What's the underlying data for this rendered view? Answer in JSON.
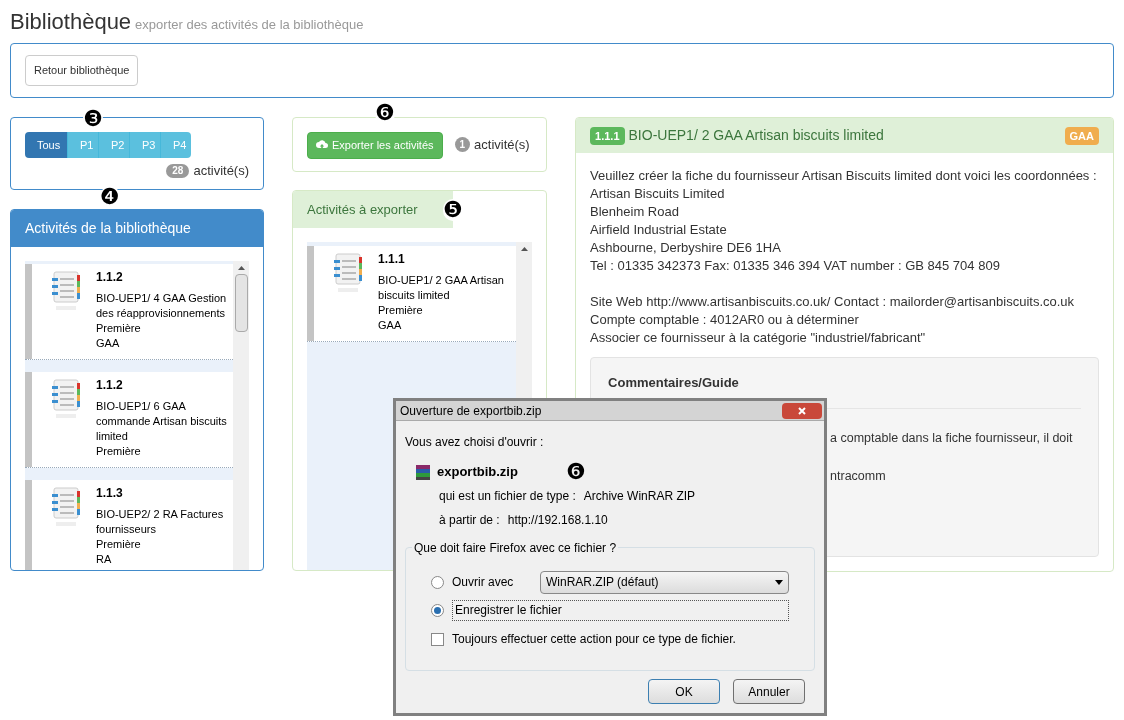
{
  "header": {
    "title": "Bibliothèque",
    "subtitle": "exporter des activités de la bibliothèque"
  },
  "back_button": "Retour bibliothèque",
  "filter": {
    "marker": "❸",
    "tabs": [
      {
        "label": "Tous",
        "selected": true
      },
      {
        "label": "P1",
        "selected": false
      },
      {
        "label": "P2",
        "selected": false
      },
      {
        "label": "P3",
        "selected": false
      },
      {
        "label": "P4",
        "selected": false
      }
    ],
    "count": "28",
    "count_label": "activité(s)"
  },
  "library": {
    "marker": "❹",
    "title": "Activités de la bibliothèque",
    "items": [
      {
        "code": "1.1.2",
        "title": "BIO-UEP1/ 4 GAA Gestion des réapprovisionnements",
        "level": "Première",
        "domain": "GAA"
      },
      {
        "code": "1.1.2",
        "title": "BIO-UEP1/ 6 GAA commande Artisan biscuits limited",
        "level": "Première"
      },
      {
        "code": "1.1.3",
        "title": "BIO-UEP2/ 2 RA Factures fournisseurs",
        "level": "Première",
        "domain": "RA"
      }
    ]
  },
  "export": {
    "marker": "❻",
    "button": "Exporter les activités",
    "count": "1",
    "count_label": "activité(s)"
  },
  "to_export": {
    "marker": "❺",
    "title": "Activités à exporter",
    "items": [
      {
        "code": "1.1.1",
        "title": "BIO-UEP1/ 2 GAA Artisan biscuits limited",
        "level": "Première",
        "domain": "GAA"
      }
    ]
  },
  "detail": {
    "code": "1.1.1",
    "title": "BIO-UEP1/ 2 GAA Artisan biscuits limited",
    "tag": "GAA",
    "paragraphs": [
      [
        "Veuillez créer la fiche du fournisseur Artisan Biscuits limited dont voici les coordonnées :",
        "Artisan Biscuits Limited",
        "Blenheim Road",
        "Airfield Industrial Estate",
        "Ashbourne, Derbyshire DE6 1HA",
        "Tel : 01335 342373 Fax: 01335 346 394 VAT number : GB 845 704 809"
      ],
      [
        "Site Web http://www.artisanbiscuits.co.uk/ Contact : mailorder@artisanbiscuits.co.uk",
        "Compte comptable : 4012AR0 ou à déterminer",
        "Associer ce fournisseur à la catégorie \"industriel/fabricant\""
      ]
    ],
    "comments": {
      "title": "Commentaires/Guide",
      "lines": [
        "a comptable dans la fiche fournisseur, il doit",
        "ntracomm"
      ]
    }
  },
  "dialog": {
    "title": "Ouverture de exportbib.zip",
    "intro": "Vous avez choisi d'ouvrir :",
    "file": "exportbib.zip",
    "marker": "❻",
    "type_label": "qui est un fichier de type :",
    "type": "Archive WinRAR ZIP",
    "from_label": "à partir de :",
    "from": "http://192.168.1.10",
    "group_title": "Que doit faire Firefox avec ce fichier ?",
    "options": [
      {
        "kind": "select",
        "label": "Ouvrir avec",
        "selected": false,
        "app": "WinRAR.ZIP (défaut)"
      },
      {
        "kind": "plain",
        "label": "Enregistrer le fichier",
        "selected": true
      }
    ],
    "always": {
      "label": "Toujours effectuer cette action pour ce type de fichier.",
      "checked": false
    },
    "buttons": [
      "OK",
      "Annuler"
    ]
  }
}
